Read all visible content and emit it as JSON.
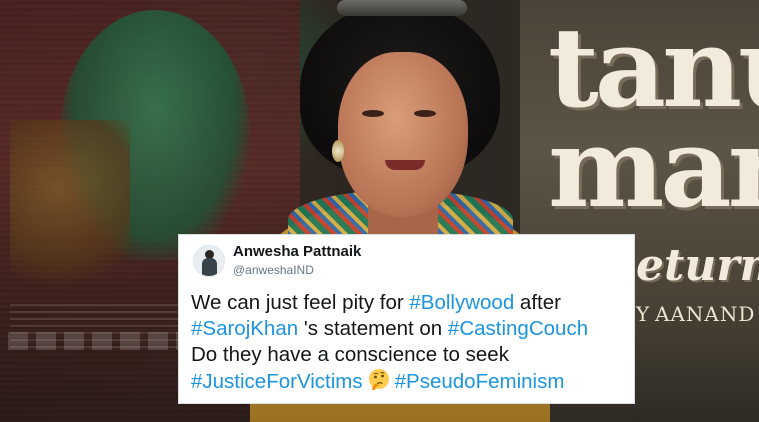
{
  "poster": {
    "title_line1": "tanu",
    "title_line2": "man",
    "title_line3": "eturn",
    "director_prefix": "Y",
    "director": "AANAND"
  },
  "tweet": {
    "author_name": "Anwesha Pattnaik",
    "author_handle": "@anweshaIND",
    "line1": {
      "t1": "We can just feel pity for ",
      "h1": "#Bollywood",
      "t2": " after"
    },
    "line2": {
      "h1": "#SarojKhan",
      "t1": " 's statement on ",
      "h2": "#CastingCouch"
    },
    "line3": {
      "t1": "Do they have a conscience to seek"
    },
    "line4": {
      "h1": "#JusticeForVictims",
      "emoji": "thinking-face-emoji",
      "h2": "#PseudoFeminism"
    },
    "hashtag_color": "#1b95e0",
    "text_color": "#14171a",
    "handle_color": "#657786"
  }
}
